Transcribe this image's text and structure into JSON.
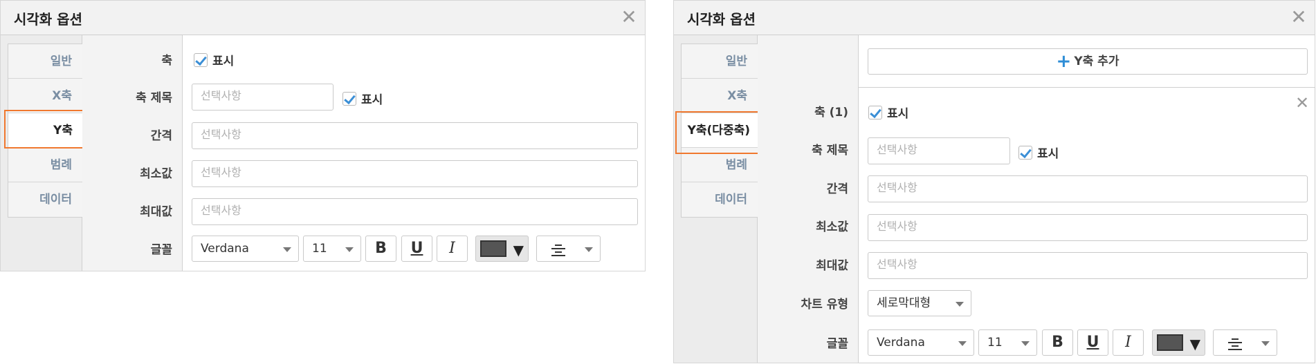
{
  "left_dialog": {
    "title": "시각화 옵션",
    "close_symbol": "✕",
    "tabs": [
      "일반",
      "X축",
      "Y축",
      "범례",
      "데이터"
    ],
    "active_tab": "Y축",
    "labels": {
      "axis": "축",
      "axis_title": "축 제목",
      "interval": "간격",
      "min": "최소값",
      "max": "최대값",
      "font": "글꼴"
    },
    "show_label": "표시",
    "placeholder": "선택사항",
    "font_family": "Verdana",
    "font_size": "11",
    "bold_symbol": "B",
    "underline_symbol": "U",
    "italic_symbol": "I",
    "color_arrow": "▼"
  },
  "right_dialog": {
    "title": "시각화 옵션",
    "close_symbol": "✕",
    "tabs": [
      "일반",
      "X축",
      "Y축(다중축)",
      "범례",
      "데이터"
    ],
    "active_tab": "Y축(다중축)",
    "add_axis_label": "Y축 추가",
    "add_axis_symbol": "+",
    "axis_close_symbol": "✕",
    "labels": {
      "axis": "축 (1)",
      "axis_title": "축 제목",
      "interval": "간격",
      "min": "최소값",
      "max": "최대값",
      "chart_type": "차트 유형",
      "font": "글꼴"
    },
    "show_label": "표시",
    "placeholder": "선택사항",
    "chart_type_value": "세로막대형",
    "font_family": "Verdana",
    "font_size": "11",
    "bold_symbol": "B",
    "underline_symbol": "U",
    "italic_symbol": "I",
    "color_arrow": "▼"
  },
  "colors": {
    "accent_highlight": "#f0782e",
    "checkbox_check": "#3b8fd6",
    "tab_text": "#7a8ea3",
    "font_color_swatch": "#555555"
  }
}
